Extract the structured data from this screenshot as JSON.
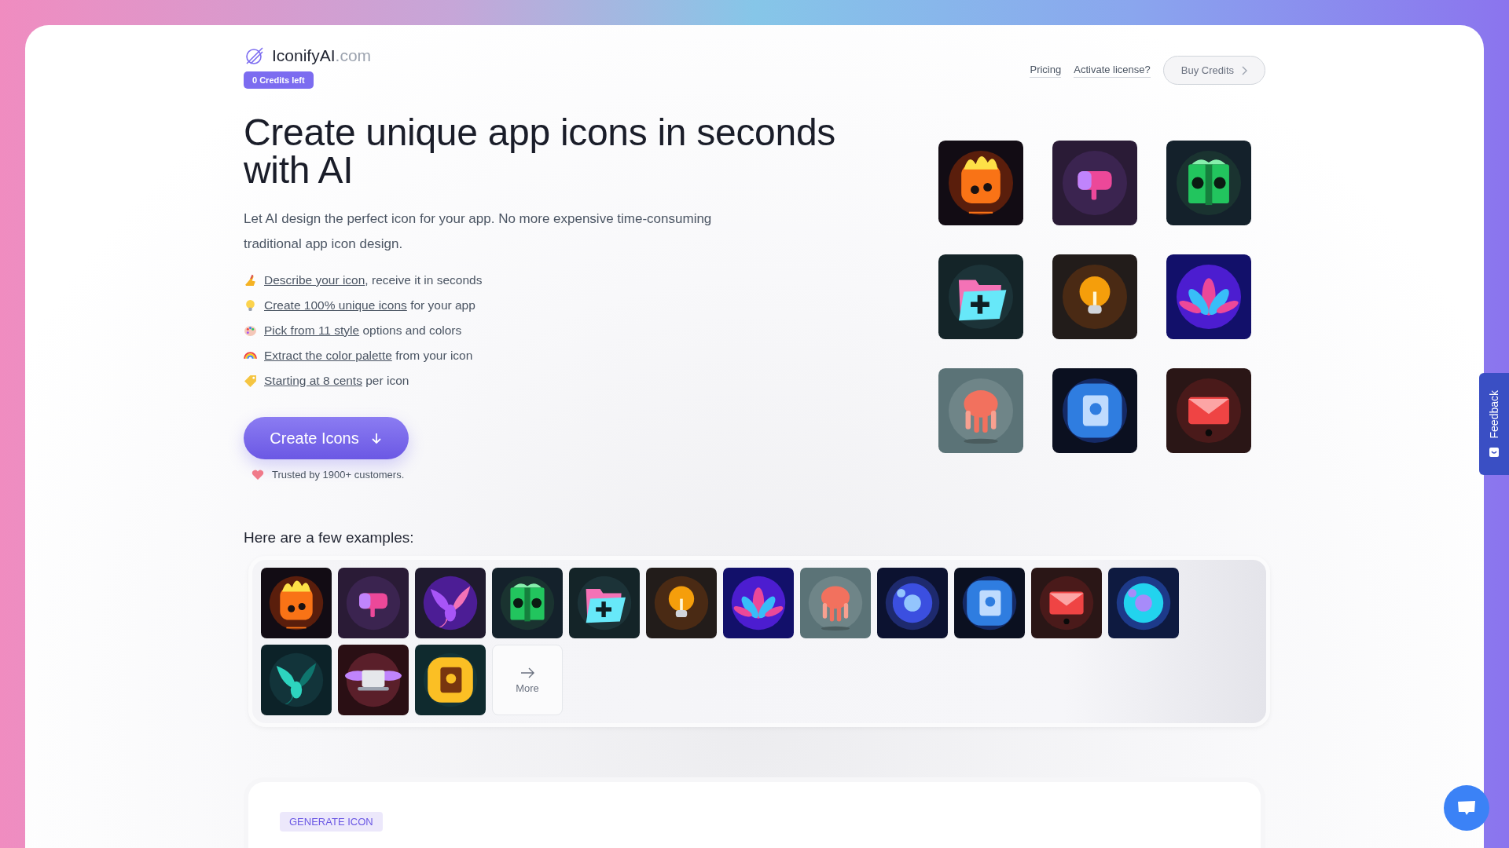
{
  "logo": {
    "name": "IconifyAI",
    "domain": ".com"
  },
  "credits_badge": "0 Credits left",
  "nav": {
    "links": [
      "Pricing",
      "Activate license?"
    ],
    "button": "Buy Credits"
  },
  "hero": {
    "title": "Create unique app icons in seconds with AI",
    "description": "Let AI design the perfect icon for your app. No more expensive time-consuming traditional app icon design.",
    "features": [
      {
        "kind": "hand",
        "link": "Describe your icon",
        "text": ", receive it in seconds"
      },
      {
        "kind": "bulb",
        "link": "Create 100% unique icons",
        "text": " for your app"
      },
      {
        "kind": "palette",
        "link": "Pick from 11 style",
        "text": " options and colors"
      },
      {
        "kind": "rainbow",
        "link": "Extract the color palette",
        "text": " from your icon"
      },
      {
        "kind": "tag",
        "link": "Starting at 8 cents",
        "text": " per icon"
      }
    ],
    "cta": "Create Icons",
    "trust": "Trusted by 1900+ customers."
  },
  "examples": {
    "heading": "Here are a few examples:",
    "more": "More"
  },
  "generate": {
    "tag": "GENERATE ICON"
  },
  "feedback_tab": "Feedback"
}
